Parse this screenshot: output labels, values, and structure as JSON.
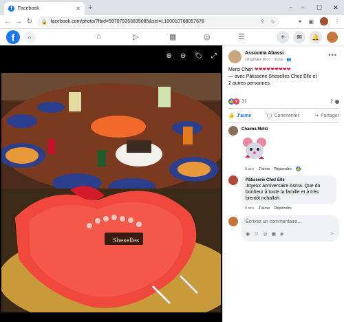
{
  "browser": {
    "tab_title": "Facebook",
    "tab_close": "✕",
    "new_tab": "+",
    "url": "facebook.com/photo/?fbid=597079353835085&set=t.100010768057678",
    "window_controls": [
      "–",
      "☐",
      "✕"
    ]
  },
  "fb_header": {
    "logo_letter": "f",
    "search_icon": "search-icon"
  },
  "post": {
    "author": "Assouma Abassi",
    "date": "10 janvier 2017",
    "location": "Tunis",
    "privacy_icon": "people-icon",
    "text_line1": "Merci Cheri",
    "hearts": "❤❤❤❤❤❤❤❤❤",
    "text_line2": "— avec Pâtisserie Sheselles Chez Elle et",
    "text_line3": "2 autres personnes.",
    "reaction_count": "31",
    "comment_count": "2"
  },
  "actions": {
    "like": "J'aime",
    "comment": "Commenter",
    "share": "Partager"
  },
  "comments": [
    {
      "author": "Chaima Melki",
      "age": "6 ans",
      "like": "J'aime",
      "reply": "Répondre"
    },
    {
      "author": "Pâtisserie Chez Elle",
      "text": "Joyeux anniversaire Asma. Que du bonheur à toute la famille et à très bientôt nchallah.",
      "age": "6 ans",
      "like": "J'aime",
      "reply": "Répondre"
    }
  ],
  "comment_input": {
    "placeholder": "Écrivez un commentaire…"
  },
  "photo": {
    "cake_label": "Sheselles"
  },
  "colors": {
    "brand": "#1877f2",
    "heart": "#e41e3f"
  }
}
